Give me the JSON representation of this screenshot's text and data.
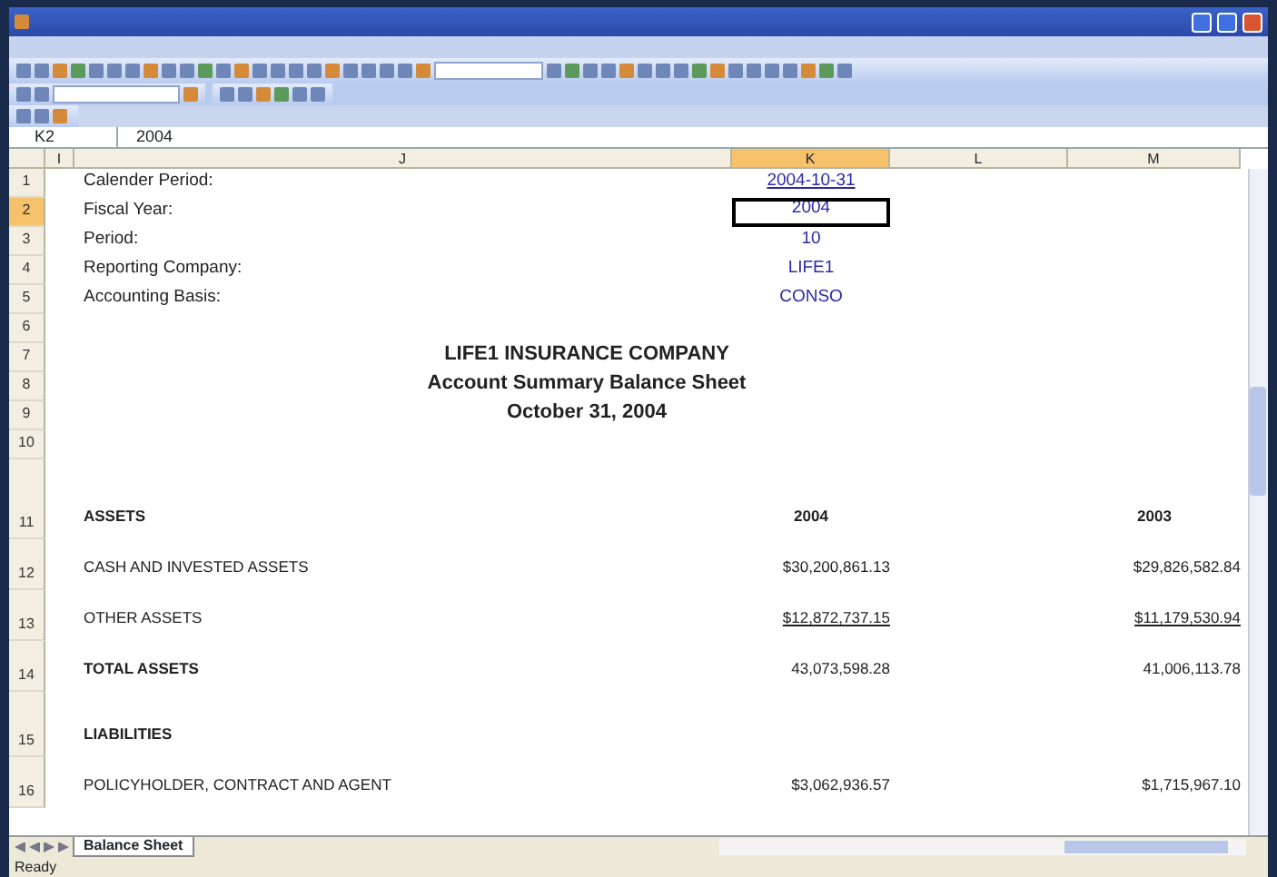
{
  "name_box": {
    "value": "K2"
  },
  "formula_bar": {
    "value": "2004"
  },
  "columns": [
    {
      "label": "I",
      "selected": false
    },
    {
      "label": "J",
      "selected": false
    },
    {
      "label": "K",
      "selected": true
    },
    {
      "label": "L",
      "selected": false
    },
    {
      "label": "M",
      "selected": false
    }
  ],
  "rows": [
    {
      "number": "1",
      "selected": false,
      "kind": "param",
      "label": "Calender Period:",
      "k": "2004-10-31"
    },
    {
      "number": "2",
      "selected": true,
      "kind": "param",
      "label": "Fiscal Year:",
      "k": "2004"
    },
    {
      "number": "3",
      "selected": false,
      "kind": "param",
      "label": "Period:",
      "k": "10"
    },
    {
      "number": "4",
      "selected": false,
      "kind": "param",
      "label": "Reporting Company:",
      "k": "LIFE1"
    },
    {
      "number": "5",
      "selected": false,
      "kind": "param",
      "label": "Accounting Basis:",
      "k": "CONSO"
    },
    {
      "number": "6",
      "selected": false,
      "kind": "blank"
    },
    {
      "number": "7",
      "selected": false,
      "kind": "title",
      "label": "LIFE1 INSURANCE COMPANY"
    },
    {
      "number": "8",
      "selected": false,
      "kind": "title",
      "label": "Account Summary Balance Sheet"
    },
    {
      "number": "9",
      "selected": false,
      "kind": "title",
      "label": "October 31, 2004"
    },
    {
      "number": "10",
      "selected": false,
      "kind": "blank"
    },
    {
      "number": "11",
      "selected": false,
      "kind": "heading",
      "label": "ASSETS",
      "k": "2004",
      "m": "2003"
    },
    {
      "number": "12",
      "selected": false,
      "kind": "line",
      "label": "CASH AND INVESTED ASSETS",
      "k": "$30,200,861.13",
      "m": "$29,826,582.84"
    },
    {
      "number": "13",
      "selected": false,
      "kind": "subtotal",
      "label": "OTHER ASSETS",
      "k": "$12,872,737.15",
      "m": "$11,179,530.94"
    },
    {
      "number": "14",
      "selected": false,
      "kind": "total",
      "label": "TOTAL ASSETS",
      "k": "43,073,598.28",
      "m": "41,006,113.78"
    },
    {
      "number": "15",
      "selected": false,
      "kind": "heading",
      "label": "LIABILITIES"
    },
    {
      "number": "16",
      "selected": false,
      "kind": "line",
      "label": "POLICYHOLDER, CONTRACT AND AGENT",
      "k": "$3,062,936.57",
      "m": "$1,715,967.10"
    }
  ],
  "sheet_tabs": [
    {
      "label": "Balance Sheet",
      "selected": true
    }
  ],
  "status_bar": {
    "text": "Ready"
  }
}
